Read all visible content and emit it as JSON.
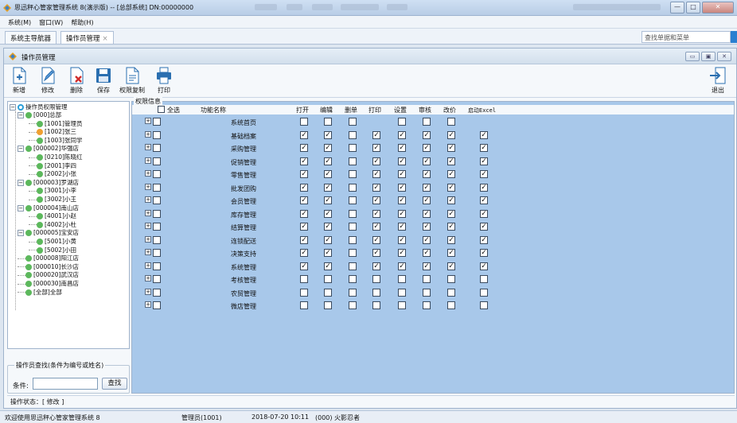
{
  "window": {
    "title": "思迅秤心管家管理系统 8(演示版) -- [总部系统] DN:00000000",
    "min": "—",
    "max": "□",
    "close": "✕"
  },
  "menu": [
    "系统(M)",
    "窗口(W)",
    "帮助(H)"
  ],
  "tabs": [
    {
      "label": "系统主导航器"
    },
    {
      "label": "操作员管理",
      "close": "×"
    }
  ],
  "search": {
    "placeholder": "查找单据和菜单"
  },
  "child": {
    "title": "操作员管理",
    "min": "▭",
    "restore": "▣",
    "close": "✕"
  },
  "toolbar": {
    "new": "新增",
    "edit": "修改",
    "delete": "删除",
    "save": "保存",
    "copy": "权限复制",
    "print": "打印",
    "exit": "退出"
  },
  "tree": {
    "root": "操作员权限管理",
    "items": [
      {
        "label": "[000]总部",
        "level": 1,
        "kind": "group"
      },
      {
        "label": "[1001]管理员",
        "level": 2,
        "kind": "user"
      },
      {
        "label": "[1002]张三",
        "level": 2,
        "kind": "user-alt"
      },
      {
        "label": "[1003]张同学",
        "level": 2,
        "kind": "user"
      },
      {
        "label": "[000002]华强店",
        "level": 1,
        "kind": "group"
      },
      {
        "label": "[0210]陈晓红",
        "level": 2,
        "kind": "user"
      },
      {
        "label": "[2001]李四",
        "level": 2,
        "kind": "user"
      },
      {
        "label": "[2002]小张",
        "level": 2,
        "kind": "user"
      },
      {
        "label": "[000003]罗湖店",
        "level": 1,
        "kind": "group"
      },
      {
        "label": "[3001]小李",
        "level": 2,
        "kind": "user"
      },
      {
        "label": "[3002]小王",
        "level": 2,
        "kind": "user"
      },
      {
        "label": "[000004]南山店",
        "level": 1,
        "kind": "group"
      },
      {
        "label": "[4001]小赵",
        "level": 2,
        "kind": "user"
      },
      {
        "label": "[4002]小杜",
        "level": 2,
        "kind": "user"
      },
      {
        "label": "[000005]宝安店",
        "level": 1,
        "kind": "group"
      },
      {
        "label": "[5001]小黄",
        "level": 2,
        "kind": "user"
      },
      {
        "label": "[5002]小田",
        "level": 2,
        "kind": "user"
      },
      {
        "label": "[000008]阳江店",
        "level": 1,
        "kind": "leafgroup"
      },
      {
        "label": "[000010]长沙店",
        "level": 1,
        "kind": "leafgroup"
      },
      {
        "label": "[000020]武汉店",
        "level": 1,
        "kind": "leafgroup"
      },
      {
        "label": "[000030]南昌店",
        "level": 1,
        "kind": "leafgroup"
      },
      {
        "label": "[全部]全部",
        "level": 1,
        "kind": "leafgroup"
      }
    ]
  },
  "operator_search": {
    "legend": "操作员查找(条件为编号或姓名)",
    "label": "条件:",
    "value": "",
    "button": "查找"
  },
  "permissions": {
    "legend": "权限信息",
    "select_all": "全选",
    "columns": [
      "功能名称",
      "打开",
      "编辑",
      "删单",
      "打印",
      "设置",
      "审核",
      "改价",
      "启动Excel"
    ],
    "rows": [
      {
        "name": "系统首页",
        "checks": [
          0,
          0,
          0,
          null,
          0,
          0,
          0,
          null
        ]
      },
      {
        "name": "基础档案",
        "checks": [
          1,
          1,
          0,
          1,
          1,
          1,
          1,
          1
        ]
      },
      {
        "name": "采购管理",
        "checks": [
          1,
          1,
          0,
          1,
          1,
          1,
          1,
          1
        ]
      },
      {
        "name": "促销管理",
        "checks": [
          1,
          1,
          0,
          1,
          1,
          1,
          1,
          1
        ]
      },
      {
        "name": "零售管理",
        "checks": [
          1,
          1,
          0,
          1,
          1,
          1,
          1,
          1
        ]
      },
      {
        "name": "批发团购",
        "checks": [
          1,
          1,
          0,
          1,
          1,
          1,
          1,
          1
        ]
      },
      {
        "name": "会员管理",
        "checks": [
          1,
          1,
          0,
          1,
          1,
          1,
          1,
          1
        ]
      },
      {
        "name": "库存管理",
        "checks": [
          1,
          1,
          0,
          1,
          1,
          1,
          1,
          1
        ]
      },
      {
        "name": "结算管理",
        "checks": [
          1,
          1,
          0,
          1,
          1,
          1,
          1,
          1
        ]
      },
      {
        "name": "连锁配送",
        "checks": [
          1,
          1,
          0,
          1,
          1,
          1,
          1,
          1
        ]
      },
      {
        "name": "决策支持",
        "checks": [
          1,
          1,
          0,
          1,
          1,
          1,
          1,
          1
        ]
      },
      {
        "name": "系统管理",
        "checks": [
          1,
          1,
          0,
          1,
          1,
          1,
          1,
          1
        ]
      },
      {
        "name": "考核管理",
        "checks": [
          0,
          0,
          0,
          0,
          0,
          0,
          0,
          0
        ]
      },
      {
        "name": "农贸管理",
        "checks": [
          0,
          0,
          0,
          0,
          0,
          0,
          0,
          0
        ]
      },
      {
        "name": "微店管理",
        "checks": [
          0,
          0,
          0,
          0,
          0,
          0,
          0,
          0
        ]
      }
    ]
  },
  "op_status": "操作状态：[ 修改 ]",
  "statusbar": {
    "welcome": "欢迎使用思迅秤心管家管理系统 8",
    "user": "管理员(1001)",
    "datetime": "2018-07-20 10:11",
    "store": "(000) 火影忍者"
  },
  "colors": {
    "grid_bg": "#a8c8ea",
    "accent": "#2a7fd0",
    "user_dot": "#5cb85c",
    "user_alt_dot": "#f0a030"
  }
}
